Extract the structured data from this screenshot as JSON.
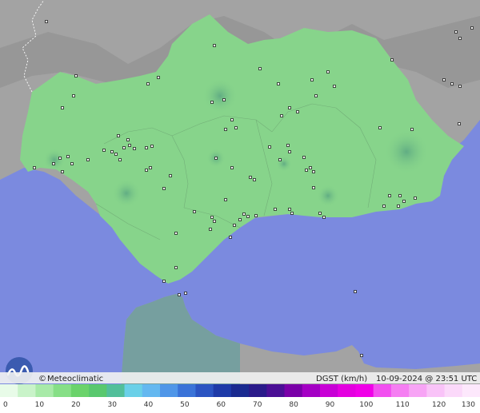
{
  "credit": {
    "copyright": "©",
    "brand": "Meteoclimatic"
  },
  "status": {
    "variable": "DGST (km/h)",
    "timestamp": "10-09-2024 @ 23:51 UTC"
  },
  "legend": {
    "ticks": [
      "0",
      "10",
      "20",
      "30",
      "40",
      "50",
      "60",
      "70",
      "80",
      "90",
      "100",
      "110",
      "120",
      "130"
    ],
    "colors": [
      "#e8fbe8",
      "#c9f3c9",
      "#a8eaa8",
      "#86df86",
      "#6bd36b",
      "#59c86e",
      "#52bf9a",
      "#6ad0e8",
      "#64b8f0",
      "#4f96e8",
      "#3a73d8",
      "#2b54c2",
      "#1e3aa8",
      "#1a2a90",
      "#2a1a8a",
      "#4b0f95",
      "#7a00a8",
      "#a400c4",
      "#c800d6",
      "#e400e0",
      "#f000e8",
      "#f24ff0",
      "#f57ef2",
      "#f7a4f5",
      "#f9c3f8",
      "#fbd9fa",
      "#fde8fc"
    ]
  },
  "colors": {
    "sea": "#7b8adf",
    "land_outside": "#9e9e9e",
    "land_andalucia": "#86d48a",
    "land_africa": "#6e9ea0",
    "infobar": "#f2f2f2"
  }
}
